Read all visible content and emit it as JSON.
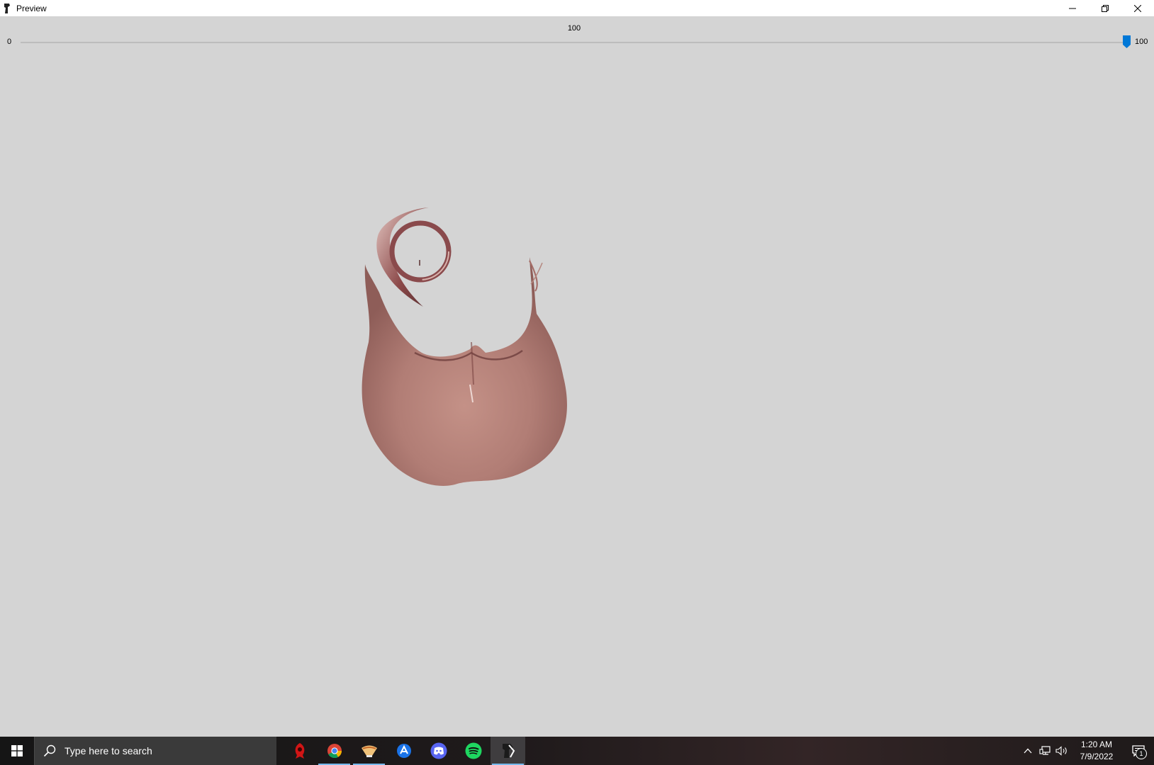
{
  "window": {
    "title": "Preview",
    "minimize_icon": "minimize-icon",
    "restore_icon": "restore-icon",
    "close_icon": "close-icon"
  },
  "slider": {
    "current_value_label": "100",
    "min_label": "0",
    "max_label": "100",
    "min": 0,
    "max": 100,
    "value": 100,
    "accent_color": "#0078d7"
  },
  "viewport": {
    "background_color": "#d4d4d4",
    "content": "3d-model-preview"
  },
  "taskbar": {
    "search_placeholder": "Type here to search",
    "apps": [
      {
        "name": "app-red-icon",
        "active": false
      },
      {
        "name": "chrome-icon",
        "active": true
      },
      {
        "name": "app-bowl-icon",
        "active": true
      },
      {
        "name": "app-blue-icon",
        "active": false
      },
      {
        "name": "discord-icon",
        "active": false
      },
      {
        "name": "spotify-icon",
        "active": false
      },
      {
        "name": "preview-app-icon",
        "active": true
      }
    ],
    "clock_time": "1:20 AM",
    "clock_date": "7/9/2022",
    "notification_count": "1"
  }
}
